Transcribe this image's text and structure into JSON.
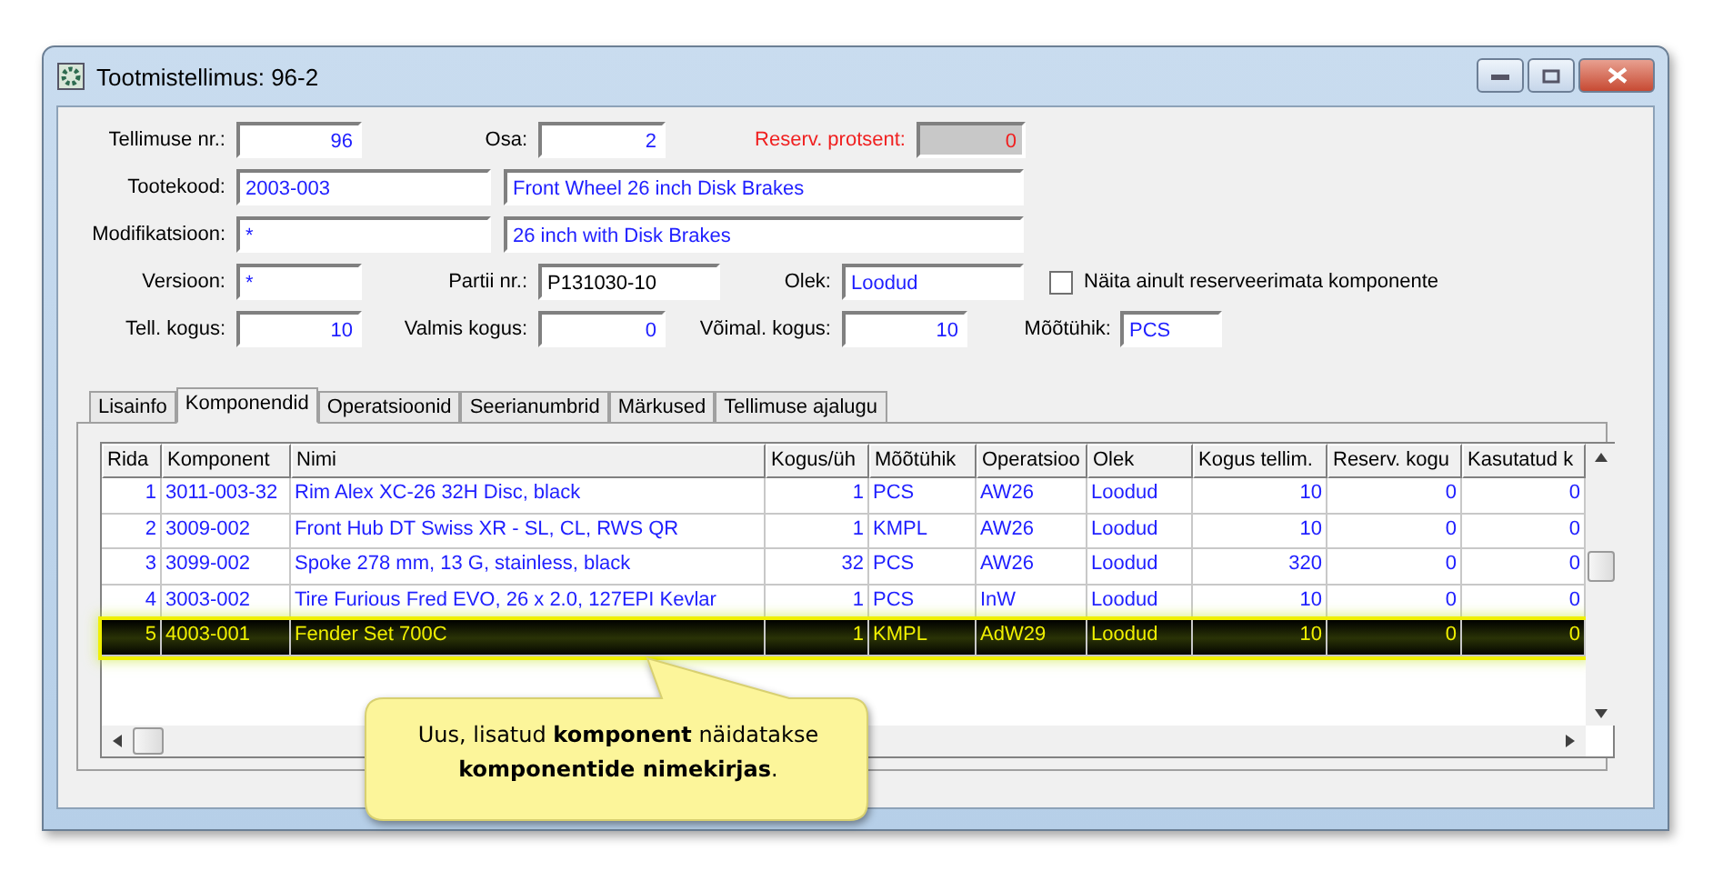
{
  "window": {
    "title": "Tootmistellimus: 96-2"
  },
  "form": {
    "order_no": {
      "label": "Tellimuse nr.:",
      "value": "96"
    },
    "part": {
      "label": "Osa:",
      "value": "2"
    },
    "reserve_percent": {
      "label": "Reserv. protsent:",
      "value": "0",
      "disabled": true
    },
    "product_code": {
      "label": "Tootekood:",
      "value": "2003-003",
      "description": "Front Wheel 26 inch Disk Brakes"
    },
    "modification": {
      "label": "Modifikatsioon:",
      "value": "*",
      "description": "26 inch with Disk Brakes"
    },
    "version": {
      "label": "Versioon:",
      "value": "*"
    },
    "batch_no": {
      "label": "Partii nr.:",
      "value": "P131030-10"
    },
    "status": {
      "label": "Olek:",
      "value": "Loodud"
    },
    "show_unreserved": {
      "label": "Näita ainult reserveerimata komponente",
      "checked": false
    },
    "ordered_qty": {
      "label": "Tell. kogus:",
      "value": "10"
    },
    "finished_qty": {
      "label": "Valmis kogus:",
      "value": "0"
    },
    "possible_qty": {
      "label": "Võimal. kogus:",
      "value": "10"
    },
    "unit": {
      "label": "Mõõtühik:",
      "value": "PCS"
    }
  },
  "tabs": [
    {
      "label": "Lisainfo",
      "selected": false
    },
    {
      "label": "Komponendid",
      "selected": true
    },
    {
      "label": "Operatsioonid",
      "selected": false
    },
    {
      "label": "Seerianumbrid",
      "selected": false
    },
    {
      "label": "Märkused",
      "selected": false
    },
    {
      "label": "Tellimuse ajalugu",
      "selected": false
    }
  ],
  "table": {
    "columns": [
      "Rida",
      "Komponent",
      "Nimi",
      "Kogus/üh",
      "Mõõtühik",
      "Operatsioo",
      "Olek",
      "Kogus tellim.",
      "Reserv. kogu",
      "Kasutatud k"
    ],
    "rows": [
      {
        "cells": [
          "1",
          "3011-003-32",
          "Rim Alex XC-26 32H Disc, black",
          "1",
          "PCS",
          "AW26",
          "Loodud",
          "10",
          "0",
          "0"
        ],
        "selected": false
      },
      {
        "cells": [
          "2",
          "3009-002",
          "Front Hub DT Swiss XR - SL, CL, RWS QR",
          "1",
          "KMPL",
          "AW26",
          "Loodud",
          "10",
          "0",
          "0"
        ],
        "selected": false
      },
      {
        "cells": [
          "3",
          "3099-002",
          "Spoke 278 mm, 13 G, stainless, black",
          "32",
          "PCS",
          "AW26",
          "Loodud",
          "320",
          "0",
          "0"
        ],
        "selected": false
      },
      {
        "cells": [
          "4",
          "3003-002",
          "Tire Furious Fred EVO, 26 x 2.0, 127EPI Kevlar",
          "1",
          "PCS",
          "InW",
          "Loodud",
          "10",
          "0",
          "0"
        ],
        "selected": false
      },
      {
        "cells": [
          "5",
          "4003-001",
          "Fender Set 700C",
          "1",
          "KMPL",
          "AdW29",
          "Loodud",
          "10",
          "0",
          "0"
        ],
        "selected": true
      }
    ]
  },
  "callout": {
    "text": "Uus, lisatud **komponent** näidatakse **komponentide nimekirjas**."
  }
}
